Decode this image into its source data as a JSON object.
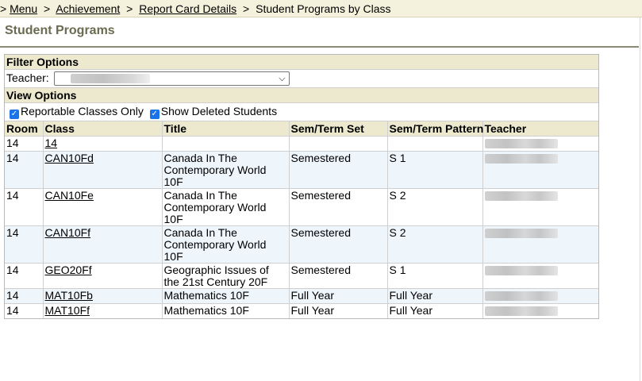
{
  "breadcrumb": {
    "lead": ">",
    "items": [
      "Menu",
      "Achievement",
      "Report Card Details"
    ],
    "separator": ">",
    "current": "Student Programs by Class"
  },
  "page": {
    "title": "Student Programs"
  },
  "filter": {
    "heading": "Filter Options",
    "teacher_label": "Teacher:",
    "teacher_value": ""
  },
  "view": {
    "heading": "View Options",
    "reportable_label": "Reportable Classes Only",
    "reportable_checked": true,
    "deleted_label": "Show Deleted Students",
    "deleted_checked": true
  },
  "table": {
    "headers": [
      "Room",
      "Class",
      "Title",
      "Sem/Term Set",
      "Sem/Term Pattern",
      "Teacher"
    ],
    "rows": [
      {
        "room": "14",
        "class": "14",
        "title": "",
        "set": "",
        "pattern": ""
      },
      {
        "room": "14",
        "class": "CAN10Fd",
        "title": "Canada In The Contemporary World 10F",
        "set": "Semestered",
        "pattern": "S 1"
      },
      {
        "room": "14",
        "class": "CAN10Fe",
        "title": "Canada In The Contemporary World 10F",
        "set": "Semestered",
        "pattern": "S 2"
      },
      {
        "room": "14",
        "class": "CAN10Ff",
        "title": "Canada In The Contemporary World 10F",
        "set": "Semestered",
        "pattern": "S 2"
      },
      {
        "room": "14",
        "class": "GEO20Ff",
        "title": "Geographic Issues of the 21st Century 20F",
        "set": "Semestered",
        "pattern": "S 1"
      },
      {
        "room": "14",
        "class": "MAT10Fb",
        "title": "Mathematics 10F",
        "set": "Full Year",
        "pattern": "Full Year"
      },
      {
        "room": "14",
        "class": "MAT10Ff",
        "title": "Mathematics 10F",
        "set": "Full Year",
        "pattern": "Full Year"
      }
    ]
  }
}
